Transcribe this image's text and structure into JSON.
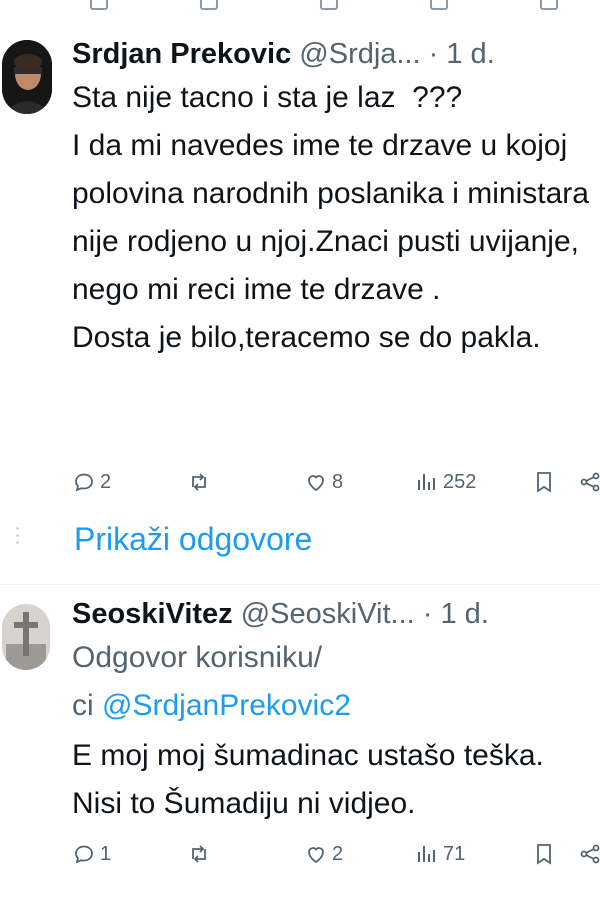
{
  "tweets": [
    {
      "author_name": "Srdjan Prekovic",
      "author_handle": "@Srdja...",
      "time": "1 d.",
      "body": "Sta nije tacno i sta je laz  ???\nI da mi navedes ime te drzave u kojoj polovina narodnih poslanika i ministara nije rodjeno u njoj.Znaci pusti uvijanje, nego mi reci ime te drzave .\nDosta je bilo,teracemo se do pakla.",
      "replies": "2",
      "reposts": "",
      "likes": "8",
      "views": "252"
    },
    {
      "author_name": "SeoskiVitez",
      "author_handle": "@SeoskiVit...",
      "time": "1 d.",
      "reply_prefix": "Odgovor korisniku/",
      "reply_prefix_2": "ci",
      "reply_to": "@SrdjanPrekovic2",
      "body": "E moj moj šumadinac ustašo teška. Nisi to Šumadiju ni vidjeo.",
      "replies": "1",
      "reposts": "",
      "likes": "2",
      "views": "71"
    }
  ],
  "show_replies_label": "Prikaži odgovore",
  "colors": {
    "accent": "#1d9bf0",
    "muted": "#536471",
    "text": "#0f1419"
  },
  "icons": [
    "reply-icon",
    "repost-icon",
    "like-icon",
    "views-icon",
    "bookmark-icon",
    "share-icon"
  ]
}
